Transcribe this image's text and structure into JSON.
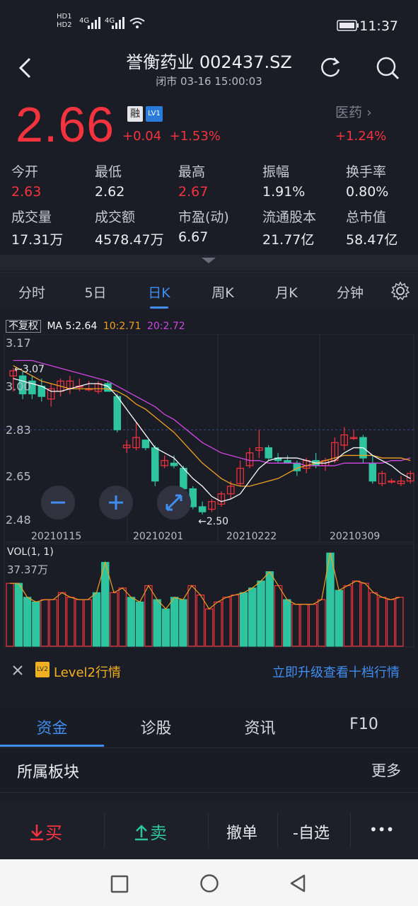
{
  "status": {
    "time": "11:37",
    "sim1": "HD1",
    "sim2": "HD2",
    "net1": "4G",
    "net2": "4G"
  },
  "header": {
    "title": "誉衡药业 002437.SZ",
    "subtitle": "闭市 03-16 15:00:03"
  },
  "quote": {
    "price": "2.66",
    "change": "+0.04",
    "change_pct": "+1.53%",
    "badge_rong": "融",
    "badge_lv": "LV1",
    "sector_name": "医药",
    "sector_pct": "+1.24%"
  },
  "stats": [
    {
      "label": "今开",
      "value": "2.63",
      "color": "#f5333f"
    },
    {
      "label": "最低",
      "value": "2.62",
      "color": "#ecedf2"
    },
    {
      "label": "最高",
      "value": "2.67",
      "color": "#f5333f"
    },
    {
      "label": "振幅",
      "value": "1.91%",
      "color": "#ecedf2"
    },
    {
      "label": "换手率",
      "value": "0.80%",
      "color": "#ecedf2"
    },
    {
      "label": "成交量",
      "value": "17.31万",
      "color": "#ecedf2"
    },
    {
      "label": "成交额",
      "value": "4578.47万",
      "color": "#ecedf2"
    },
    {
      "label": "市盈(动)",
      "value": "6.67",
      "color": "#ecedf2"
    },
    {
      "label": "流通股本",
      "value": "21.77亿",
      "color": "#ecedf2"
    },
    {
      "label": "总市值",
      "value": "58.47亿",
      "color": "#ecedf2"
    }
  ],
  "chart_tabs": [
    "分时",
    "5日",
    "日K",
    "周K",
    "月K",
    "分钟"
  ],
  "active_chart_tab": "日K",
  "ma_legend": {
    "mode": "不复权",
    "ma5": "MA 5:2.64",
    "ma10": "10:2.71",
    "ma20": "20:2.72",
    "ma5_color": "#ffffff",
    "ma10_color": "#f0a020",
    "ma20_color": "#d046e0"
  },
  "chart_data": {
    "type": "candlestick",
    "y_ticks": [
      "3.17",
      "3.00",
      "2.83",
      "2.65",
      "2.48"
    ],
    "x_ticks": [
      "20210115",
      "20210201",
      "20210222",
      "20210309"
    ],
    "annotation_high": "←3.07",
    "annotation_low": "←2.50",
    "ylim": [
      2.48,
      3.17
    ],
    "up_color": "#f5333f",
    "down_color": "#2ec4a0",
    "candles": [
      {
        "o": 3.04,
        "h": 3.07,
        "l": 2.98,
        "c": 3.06
      },
      {
        "o": 3.04,
        "h": 3.06,
        "l": 2.95,
        "c": 2.97
      },
      {
        "o": 3.02,
        "h": 3.04,
        "l": 2.95,
        "c": 2.97
      },
      {
        "o": 3.0,
        "h": 3.03,
        "l": 2.94,
        "c": 2.96
      },
      {
        "o": 2.95,
        "h": 3.01,
        "l": 2.92,
        "c": 2.99
      },
      {
        "o": 2.98,
        "h": 3.03,
        "l": 2.96,
        "c": 3.02
      },
      {
        "o": 2.99,
        "h": 3.04,
        "l": 2.97,
        "c": 3.02
      },
      {
        "o": 3.0,
        "h": 3.03,
        "l": 2.98,
        "c": 3.0
      },
      {
        "o": 2.99,
        "h": 3.02,
        "l": 2.98,
        "c": 2.99
      },
      {
        "o": 2.98,
        "h": 3.02,
        "l": 2.97,
        "c": 3.01
      },
      {
        "o": 3.01,
        "h": 3.02,
        "l": 2.98,
        "c": 2.98
      },
      {
        "o": 2.96,
        "h": 2.97,
        "l": 2.82,
        "c": 2.83
      },
      {
        "o": 2.76,
        "h": 2.79,
        "l": 2.74,
        "c": 2.77
      },
      {
        "o": 2.76,
        "h": 2.86,
        "l": 2.75,
        "c": 2.8
      },
      {
        "o": 2.79,
        "h": 2.79,
        "l": 2.75,
        "c": 2.76
      },
      {
        "o": 2.76,
        "h": 2.77,
        "l": 2.61,
        "c": 2.63
      },
      {
        "o": 2.69,
        "h": 2.73,
        "l": 2.68,
        "c": 2.71
      },
      {
        "o": 2.7,
        "h": 2.73,
        "l": 2.68,
        "c": 2.69
      },
      {
        "o": 2.68,
        "h": 2.69,
        "l": 2.6,
        "c": 2.6
      },
      {
        "o": 2.6,
        "h": 2.61,
        "l": 2.52,
        "c": 2.53
      },
      {
        "o": 2.53,
        "h": 2.55,
        "l": 2.5,
        "c": 2.51
      },
      {
        "o": 2.52,
        "h": 2.56,
        "l": 2.51,
        "c": 2.55
      },
      {
        "o": 2.54,
        "h": 2.59,
        "l": 2.53,
        "c": 2.58
      },
      {
        "o": 2.58,
        "h": 2.63,
        "l": 2.56,
        "c": 2.61
      },
      {
        "o": 2.62,
        "h": 2.71,
        "l": 2.61,
        "c": 2.68
      },
      {
        "o": 2.69,
        "h": 2.76,
        "l": 2.68,
        "c": 2.74
      },
      {
        "o": 2.75,
        "h": 2.83,
        "l": 2.72,
        "c": 2.76
      },
      {
        "o": 2.76,
        "h": 2.77,
        "l": 2.71,
        "c": 2.72
      },
      {
        "o": 2.72,
        "h": 2.74,
        "l": 2.7,
        "c": 2.71
      },
      {
        "o": 2.71,
        "h": 2.73,
        "l": 2.7,
        "c": 2.7
      },
      {
        "o": 2.7,
        "h": 2.71,
        "l": 2.65,
        "c": 2.67
      },
      {
        "o": 2.68,
        "h": 2.72,
        "l": 2.66,
        "c": 2.71
      },
      {
        "o": 2.71,
        "h": 2.74,
        "l": 2.68,
        "c": 2.69
      },
      {
        "o": 2.69,
        "h": 2.72,
        "l": 2.67,
        "c": 2.71
      },
      {
        "o": 2.71,
        "h": 2.8,
        "l": 2.7,
        "c": 2.78
      },
      {
        "o": 2.77,
        "h": 2.84,
        "l": 2.75,
        "c": 2.81
      },
      {
        "o": 2.8,
        "h": 2.83,
        "l": 2.79,
        "c": 2.8
      },
      {
        "o": 2.8,
        "h": 2.81,
        "l": 2.7,
        "c": 2.72
      },
      {
        "o": 2.7,
        "h": 2.73,
        "l": 2.62,
        "c": 2.63
      },
      {
        "o": 2.62,
        "h": 2.67,
        "l": 2.61,
        "c": 2.66
      },
      {
        "o": 2.63,
        "h": 2.64,
        "l": 2.62,
        "c": 2.63
      },
      {
        "o": 2.62,
        "h": 2.65,
        "l": 2.61,
        "c": 2.63
      },
      {
        "o": 2.63,
        "h": 2.67,
        "l": 2.62,
        "c": 2.66
      }
    ],
    "ma5": [
      3.03,
      3.02,
      3.01,
      3.0,
      2.98,
      2.98,
      2.99,
      3.0,
      3.01,
      3.01,
      3.0,
      2.96,
      2.91,
      2.86,
      2.81,
      2.76,
      2.74,
      2.72,
      2.68,
      2.64,
      2.61,
      2.57,
      2.55,
      2.56,
      2.58,
      2.63,
      2.68,
      2.71,
      2.72,
      2.72,
      2.72,
      2.71,
      2.7,
      2.7,
      2.71,
      2.74,
      2.76,
      2.76,
      2.73,
      2.71,
      2.69,
      2.66,
      2.64
    ],
    "ma10": [
      3.08,
      3.06,
      3.04,
      3.02,
      3.01,
      3.0,
      2.99,
      2.99,
      2.99,
      2.99,
      2.99,
      2.98,
      2.96,
      2.93,
      2.91,
      2.88,
      2.85,
      2.82,
      2.78,
      2.74,
      2.7,
      2.67,
      2.64,
      2.62,
      2.61,
      2.61,
      2.62,
      2.63,
      2.64,
      2.66,
      2.68,
      2.69,
      2.7,
      2.71,
      2.72,
      2.73,
      2.73,
      2.73,
      2.73,
      2.72,
      2.72,
      2.72,
      2.71
    ],
    "ma20": [
      3.1,
      3.1,
      3.1,
      3.09,
      3.08,
      3.07,
      3.06,
      3.05,
      3.04,
      3.03,
      3.02,
      3.0,
      2.98,
      2.96,
      2.94,
      2.92,
      2.89,
      2.87,
      2.84,
      2.81,
      2.78,
      2.76,
      2.74,
      2.73,
      2.72,
      2.71,
      2.71,
      2.7,
      2.7,
      2.7,
      2.7,
      2.69,
      2.69,
      2.69,
      2.69,
      2.7,
      2.7,
      2.7,
      2.7,
      2.7,
      2.71,
      2.71,
      2.72
    ]
  },
  "vol_data": {
    "label": "VOL(1, 1)",
    "max_label": "37.37万",
    "values": [
      27,
      27,
      21,
      19,
      20,
      20,
      23,
      21,
      20,
      20,
      23,
      36,
      23,
      25,
      21,
      19,
      26,
      20,
      16,
      21,
      20,
      26,
      22,
      16,
      19,
      21,
      22,
      23,
      25,
      28,
      32,
      26,
      20,
      18,
      18,
      18,
      20,
      40,
      24,
      26,
      28,
      27,
      23,
      21,
      20,
      21
    ],
    "ymax": 37.37
  },
  "level2": {
    "label": "Level2行情",
    "badge": "LV2",
    "cta": "立即升级查看十档行情"
  },
  "bottom_tabs": [
    "资金",
    "诊股",
    "资讯",
    "F10"
  ],
  "active_bottom_tab": "资金",
  "sector_section": {
    "title": "所属板块",
    "more": "更多"
  },
  "actions": {
    "buy": "买",
    "sell": "卖",
    "cancel": "撤单",
    "watch": "-自选",
    "more": "•••"
  }
}
